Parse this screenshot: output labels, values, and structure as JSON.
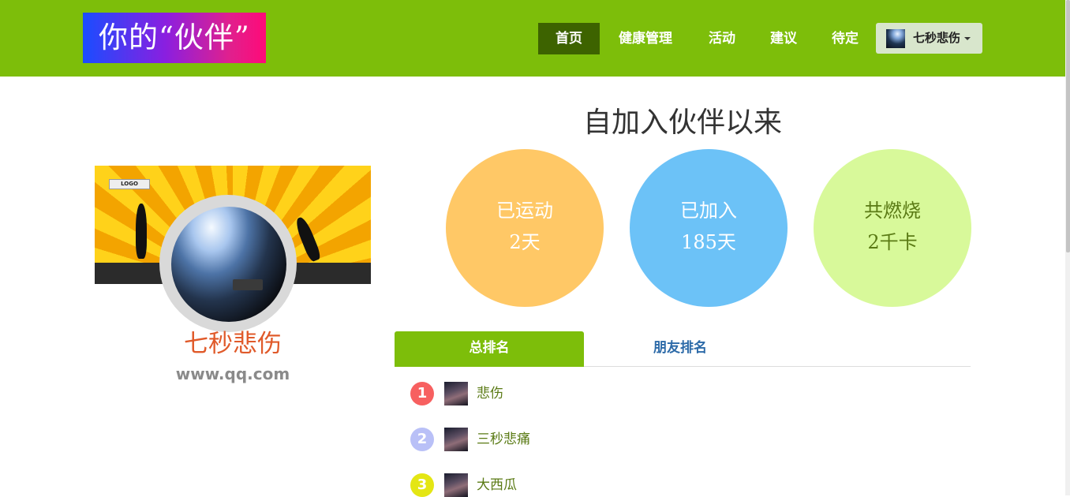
{
  "header": {
    "logo_text": "你的“伙伴”",
    "nav": [
      {
        "label": "首页",
        "active": true
      },
      {
        "label": "健康管理",
        "active": false
      },
      {
        "label": "活动",
        "active": false
      },
      {
        "label": "建议",
        "active": false
      },
      {
        "label": "待定",
        "active": false
      }
    ],
    "user_menu": {
      "name": "七秒悲伤",
      "icon": "chevron-down-icon"
    }
  },
  "profile": {
    "banner_logo": "LOGO",
    "name": "七秒悲伤",
    "url": "www.qq.com"
  },
  "stats": {
    "title": "自加入伙伴以来",
    "items": [
      {
        "label": "已运动",
        "value": "2天",
        "bg": "#ffc866",
        "color": "#ffffff"
      },
      {
        "label": "已加入",
        "value": "185天",
        "bg": "#6cc2f7",
        "color": "#ffffff"
      },
      {
        "label": "共燃烧",
        "value": "2千卡",
        "bg": "#d8f99a",
        "color": "#5a7a14"
      }
    ]
  },
  "tabs": [
    {
      "label": "总排名",
      "active": true
    },
    {
      "label": "朋友排名",
      "active": false
    }
  ],
  "ranking": [
    {
      "rank": "1",
      "name": "悲伤",
      "badge_color": "#f76060"
    },
    {
      "rank": "2",
      "name": "三秒悲痛",
      "badge_color": "#b9c0f7"
    },
    {
      "rank": "3",
      "name": "大西瓜",
      "badge_color": "#e4e614"
    }
  ],
  "colors": {
    "brand": "#7dbe0a",
    "nav_active": "#3d6300"
  }
}
